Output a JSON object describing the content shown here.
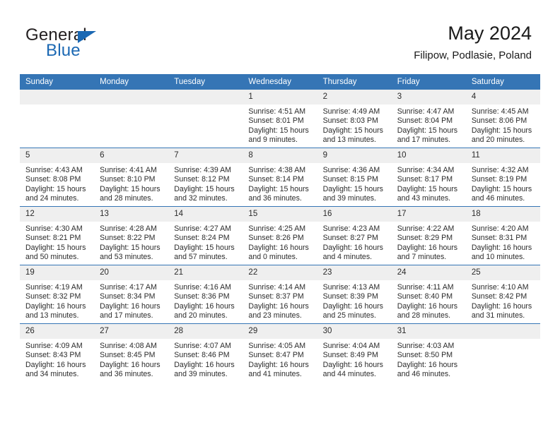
{
  "brand": {
    "name_top": "General",
    "name_bottom": "Blue",
    "accent_color": "#1b68b3"
  },
  "header": {
    "title": "May 2024",
    "subtitle": "Filipow, Podlasie, Poland"
  },
  "calendar": {
    "header_bg": "#3575b5",
    "daynum_bg": "#efefef",
    "weekdays": [
      "Sunday",
      "Monday",
      "Tuesday",
      "Wednesday",
      "Thursday",
      "Friday",
      "Saturday"
    ],
    "weeks": [
      [
        {
          "day": "",
          "lines": []
        },
        {
          "day": "",
          "lines": []
        },
        {
          "day": "",
          "lines": []
        },
        {
          "day": "1",
          "lines": [
            "Sunrise: 4:51 AM",
            "Sunset: 8:01 PM",
            "Daylight: 15 hours",
            "and 9 minutes."
          ]
        },
        {
          "day": "2",
          "lines": [
            "Sunrise: 4:49 AM",
            "Sunset: 8:03 PM",
            "Daylight: 15 hours",
            "and 13 minutes."
          ]
        },
        {
          "day": "3",
          "lines": [
            "Sunrise: 4:47 AM",
            "Sunset: 8:04 PM",
            "Daylight: 15 hours",
            "and 17 minutes."
          ]
        },
        {
          "day": "4",
          "lines": [
            "Sunrise: 4:45 AM",
            "Sunset: 8:06 PM",
            "Daylight: 15 hours",
            "and 20 minutes."
          ]
        }
      ],
      [
        {
          "day": "5",
          "lines": [
            "Sunrise: 4:43 AM",
            "Sunset: 8:08 PM",
            "Daylight: 15 hours",
            "and 24 minutes."
          ]
        },
        {
          "day": "6",
          "lines": [
            "Sunrise: 4:41 AM",
            "Sunset: 8:10 PM",
            "Daylight: 15 hours",
            "and 28 minutes."
          ]
        },
        {
          "day": "7",
          "lines": [
            "Sunrise: 4:39 AM",
            "Sunset: 8:12 PM",
            "Daylight: 15 hours",
            "and 32 minutes."
          ]
        },
        {
          "day": "8",
          "lines": [
            "Sunrise: 4:38 AM",
            "Sunset: 8:14 PM",
            "Daylight: 15 hours",
            "and 36 minutes."
          ]
        },
        {
          "day": "9",
          "lines": [
            "Sunrise: 4:36 AM",
            "Sunset: 8:15 PM",
            "Daylight: 15 hours",
            "and 39 minutes."
          ]
        },
        {
          "day": "10",
          "lines": [
            "Sunrise: 4:34 AM",
            "Sunset: 8:17 PM",
            "Daylight: 15 hours",
            "and 43 minutes."
          ]
        },
        {
          "day": "11",
          "lines": [
            "Sunrise: 4:32 AM",
            "Sunset: 8:19 PM",
            "Daylight: 15 hours",
            "and 46 minutes."
          ]
        }
      ],
      [
        {
          "day": "12",
          "lines": [
            "Sunrise: 4:30 AM",
            "Sunset: 8:21 PM",
            "Daylight: 15 hours",
            "and 50 minutes."
          ]
        },
        {
          "day": "13",
          "lines": [
            "Sunrise: 4:28 AM",
            "Sunset: 8:22 PM",
            "Daylight: 15 hours",
            "and 53 minutes."
          ]
        },
        {
          "day": "14",
          "lines": [
            "Sunrise: 4:27 AM",
            "Sunset: 8:24 PM",
            "Daylight: 15 hours",
            "and 57 minutes."
          ]
        },
        {
          "day": "15",
          "lines": [
            "Sunrise: 4:25 AM",
            "Sunset: 8:26 PM",
            "Daylight: 16 hours",
            "and 0 minutes."
          ]
        },
        {
          "day": "16",
          "lines": [
            "Sunrise: 4:23 AM",
            "Sunset: 8:27 PM",
            "Daylight: 16 hours",
            "and 4 minutes."
          ]
        },
        {
          "day": "17",
          "lines": [
            "Sunrise: 4:22 AM",
            "Sunset: 8:29 PM",
            "Daylight: 16 hours",
            "and 7 minutes."
          ]
        },
        {
          "day": "18",
          "lines": [
            "Sunrise: 4:20 AM",
            "Sunset: 8:31 PM",
            "Daylight: 16 hours",
            "and 10 minutes."
          ]
        }
      ],
      [
        {
          "day": "19",
          "lines": [
            "Sunrise: 4:19 AM",
            "Sunset: 8:32 PM",
            "Daylight: 16 hours",
            "and 13 minutes."
          ]
        },
        {
          "day": "20",
          "lines": [
            "Sunrise: 4:17 AM",
            "Sunset: 8:34 PM",
            "Daylight: 16 hours",
            "and 17 minutes."
          ]
        },
        {
          "day": "21",
          "lines": [
            "Sunrise: 4:16 AM",
            "Sunset: 8:36 PM",
            "Daylight: 16 hours",
            "and 20 minutes."
          ]
        },
        {
          "day": "22",
          "lines": [
            "Sunrise: 4:14 AM",
            "Sunset: 8:37 PM",
            "Daylight: 16 hours",
            "and 23 minutes."
          ]
        },
        {
          "day": "23",
          "lines": [
            "Sunrise: 4:13 AM",
            "Sunset: 8:39 PM",
            "Daylight: 16 hours",
            "and 25 minutes."
          ]
        },
        {
          "day": "24",
          "lines": [
            "Sunrise: 4:11 AM",
            "Sunset: 8:40 PM",
            "Daylight: 16 hours",
            "and 28 minutes."
          ]
        },
        {
          "day": "25",
          "lines": [
            "Sunrise: 4:10 AM",
            "Sunset: 8:42 PM",
            "Daylight: 16 hours",
            "and 31 minutes."
          ]
        }
      ],
      [
        {
          "day": "26",
          "lines": [
            "Sunrise: 4:09 AM",
            "Sunset: 8:43 PM",
            "Daylight: 16 hours",
            "and 34 minutes."
          ]
        },
        {
          "day": "27",
          "lines": [
            "Sunrise: 4:08 AM",
            "Sunset: 8:45 PM",
            "Daylight: 16 hours",
            "and 36 minutes."
          ]
        },
        {
          "day": "28",
          "lines": [
            "Sunrise: 4:07 AM",
            "Sunset: 8:46 PM",
            "Daylight: 16 hours",
            "and 39 minutes."
          ]
        },
        {
          "day": "29",
          "lines": [
            "Sunrise: 4:05 AM",
            "Sunset: 8:47 PM",
            "Daylight: 16 hours",
            "and 41 minutes."
          ]
        },
        {
          "day": "30",
          "lines": [
            "Sunrise: 4:04 AM",
            "Sunset: 8:49 PM",
            "Daylight: 16 hours",
            "and 44 minutes."
          ]
        },
        {
          "day": "31",
          "lines": [
            "Sunrise: 4:03 AM",
            "Sunset: 8:50 PM",
            "Daylight: 16 hours",
            "and 46 minutes."
          ]
        },
        {
          "day": "",
          "lines": []
        }
      ]
    ]
  }
}
